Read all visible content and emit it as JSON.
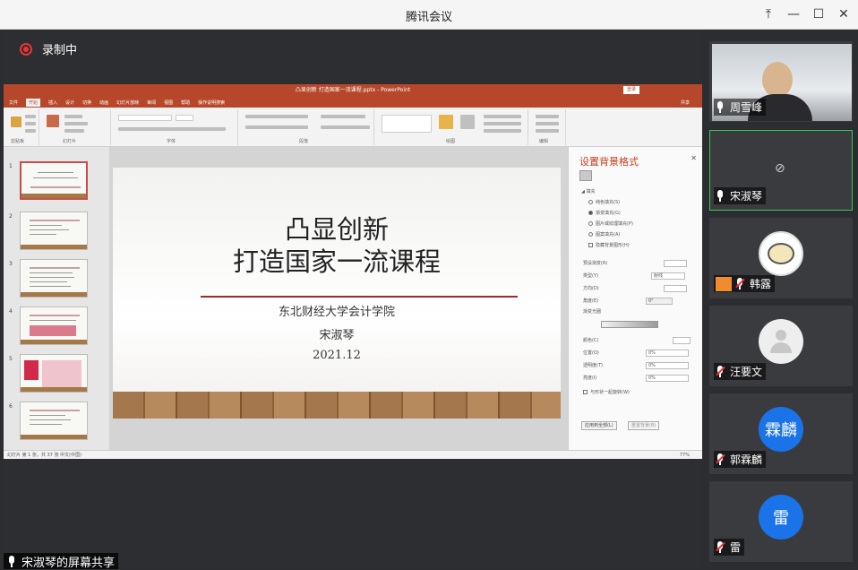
{
  "window": {
    "title": "腾讯会议"
  },
  "recording": {
    "label": "录制中"
  },
  "ppt": {
    "title_bar": "凸显创新 打造国家一流课程.pptx - PowerPoint",
    "login": "登录",
    "tabs": [
      "文件",
      "开始",
      "插入",
      "设计",
      "切换",
      "动画",
      "幻灯片放映",
      "审阅",
      "视图",
      "帮助",
      "操作说明搜索"
    ],
    "share_label": "共享",
    "ribbon_groups": [
      "剪贴板",
      "幻灯片",
      "字体",
      "段落",
      "绘图",
      "编辑"
    ],
    "slide_numbers": [
      "1",
      "2",
      "3",
      "4",
      "5",
      "6"
    ],
    "slide": {
      "line1": "凸显创新",
      "line2": "打造国家一流课程",
      "org": "东北财经大学会计学院",
      "author": "宋淑琴",
      "date": "2021.12"
    },
    "pane": {
      "title": "设置背景格式",
      "section": "填充",
      "fill_options": [
        "纯色填充(S)",
        "渐变填充(G)",
        "图片或纹理填充(P)",
        "图案填充(A)",
        "隐藏背景图形(H)"
      ],
      "fields": [
        {
          "label": "预设渐变(R)",
          "value": ""
        },
        {
          "label": "类型(Y)",
          "value": "射线"
        },
        {
          "label": "方向(D)",
          "value": ""
        },
        {
          "label": "角度(E)",
          "value": "0°"
        },
        {
          "label": "渐变光圈",
          "value": ""
        },
        {
          "label": "颜色(C)",
          "value": ""
        },
        {
          "label": "位置(O)",
          "value": "0%"
        },
        {
          "label": "透明度(T)",
          "value": "0%"
        },
        {
          "label": "亮度(I)",
          "value": "0%"
        }
      ],
      "rotate_label": "与形状一起旋转(W)",
      "apply_all": "应用到全部(L)",
      "reset": "重置背景(B)"
    },
    "status": {
      "left": "幻灯片 第 1 张，共 37 张    中文(中国)",
      "zoom": "77%"
    }
  },
  "participants": [
    {
      "name": "周雪峰",
      "muted": false,
      "type": "video"
    },
    {
      "name": "宋淑琴",
      "muted": false,
      "type": "camera-off"
    },
    {
      "name": "韩露",
      "muted": true,
      "type": "cartoon"
    },
    {
      "name": "汪要文",
      "muted": true,
      "type": "default"
    },
    {
      "name": "郭霖麟",
      "muted": true,
      "type": "initials",
      "initials": "霖麟"
    },
    {
      "name": "雷",
      "muted": true,
      "type": "initials",
      "initials": "雷"
    }
  ],
  "screen_share": {
    "label": "宋淑琴的屏幕共享"
  },
  "colors": {
    "ppt_red": "#b7472a",
    "active_border": "#3cc65b",
    "avatar_blue": "#1a73e8",
    "record_red": "#e33333"
  }
}
